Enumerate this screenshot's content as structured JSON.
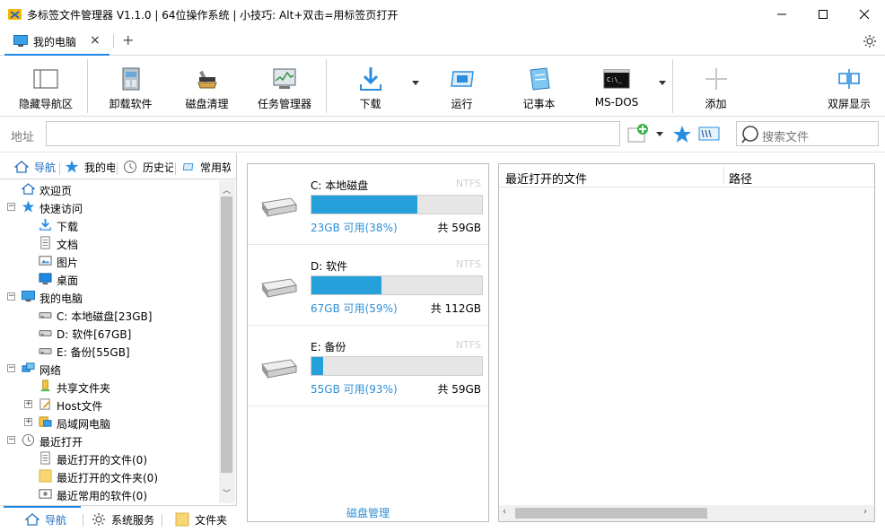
{
  "window": {
    "title": "多标签文件管理器 V1.1.0  |  64位操作系统 | 小技巧: Alt+双击=用标签页打开",
    "icons": [
      "app-icon",
      "minimize-icon",
      "maximize-icon",
      "close-icon"
    ]
  },
  "tabs": {
    "active_label": "我的电脑",
    "new_tab": "+"
  },
  "toolbar": {
    "hide_nav": "隐藏导航区",
    "uninstall": "卸载软件",
    "disk_clean": "磁盘清理",
    "task_mgr": "任务管理器",
    "download": "下载",
    "run": "运行",
    "notepad": "记事本",
    "msdos": "MS-DOS",
    "add": "添加",
    "dual": "双屏显示"
  },
  "address": {
    "label": "地址",
    "value": "",
    "search_placeholder": "搜索文件"
  },
  "left_tabs": {
    "nav": "导航",
    "mypc": "我的电脑",
    "history": "历史记录",
    "common": "常用软件"
  },
  "tree": {
    "welcome": "欢迎页",
    "quick": "快速访问",
    "download": "下载",
    "docs": "文档",
    "pics": "图片",
    "desktop": "桌面",
    "mypc": "我的电脑",
    "c": "C: 本地磁盘[23GB]",
    "d": "D: 软件[67GB]",
    "e": "E: 备份[55GB]",
    "network": "网络",
    "share": "共享文件夹",
    "host": "Host文件",
    "lan": "局域网电脑",
    "recent": "最近打开",
    "recent_files": "最近打开的文件(0)",
    "recent_folders": "最近打开的文件夹(0)",
    "recent_soft": "最近常用的软件(0)"
  },
  "bottom_tabs": {
    "nav": "导航",
    "sys": "系统服务",
    "folder": "文件夹"
  },
  "drives": [
    {
      "name": "C: 本地磁盘",
      "fs": "NTFS",
      "free": "23GB 可用(38%)",
      "total": "共 59GB",
      "used_fraction": 0.62
    },
    {
      "name": "D: 软件",
      "fs": "NTFS",
      "free": "67GB 可用(59%)",
      "total": "共 112GB",
      "used_fraction": 0.41
    },
    {
      "name": "E: 备份",
      "fs": "NTFS",
      "free": "55GB 可用(93%)",
      "total": "共 59GB",
      "used_fraction": 0.07
    }
  ],
  "disk_manage": "磁盘管理",
  "recent": {
    "col_file": "最近打开的文件",
    "col_path": "路径"
  },
  "colors": {
    "accent": "#26a0da",
    "link": "#2f8fd6"
  }
}
